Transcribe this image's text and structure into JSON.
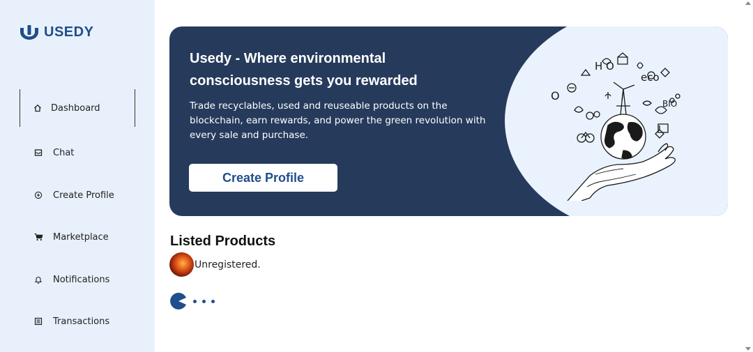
{
  "brand": {
    "name": "USEDY",
    "color": "#1f4e8c"
  },
  "sidebar": {
    "items": [
      {
        "label": "Dashboard",
        "icon": "home-icon",
        "active": true
      },
      {
        "label": "Chat",
        "icon": "inbox-icon"
      },
      {
        "label": "Create Profile",
        "icon": "plus-circle-icon"
      },
      {
        "label": "Marketplace",
        "icon": "cart-icon"
      },
      {
        "label": "Notifications",
        "icon": "bell-icon"
      },
      {
        "label": "Transactions",
        "icon": "receipt-icon"
      }
    ]
  },
  "hero": {
    "title": "Usedy - Where environmental consciousness gets you rewarded",
    "description": "Trade recyclables, used and reuseable products on the blockchain, earn rewards, and power the green revolution with every sale and purchase.",
    "button_label": "Create Profile",
    "background": "#263b5c",
    "art_labels": {
      "h2o": "H O",
      "eco": "eco",
      "bio": "BIO",
      "o2": "O"
    }
  },
  "products": {
    "title": "Listed Products",
    "status": "Unregistered."
  }
}
